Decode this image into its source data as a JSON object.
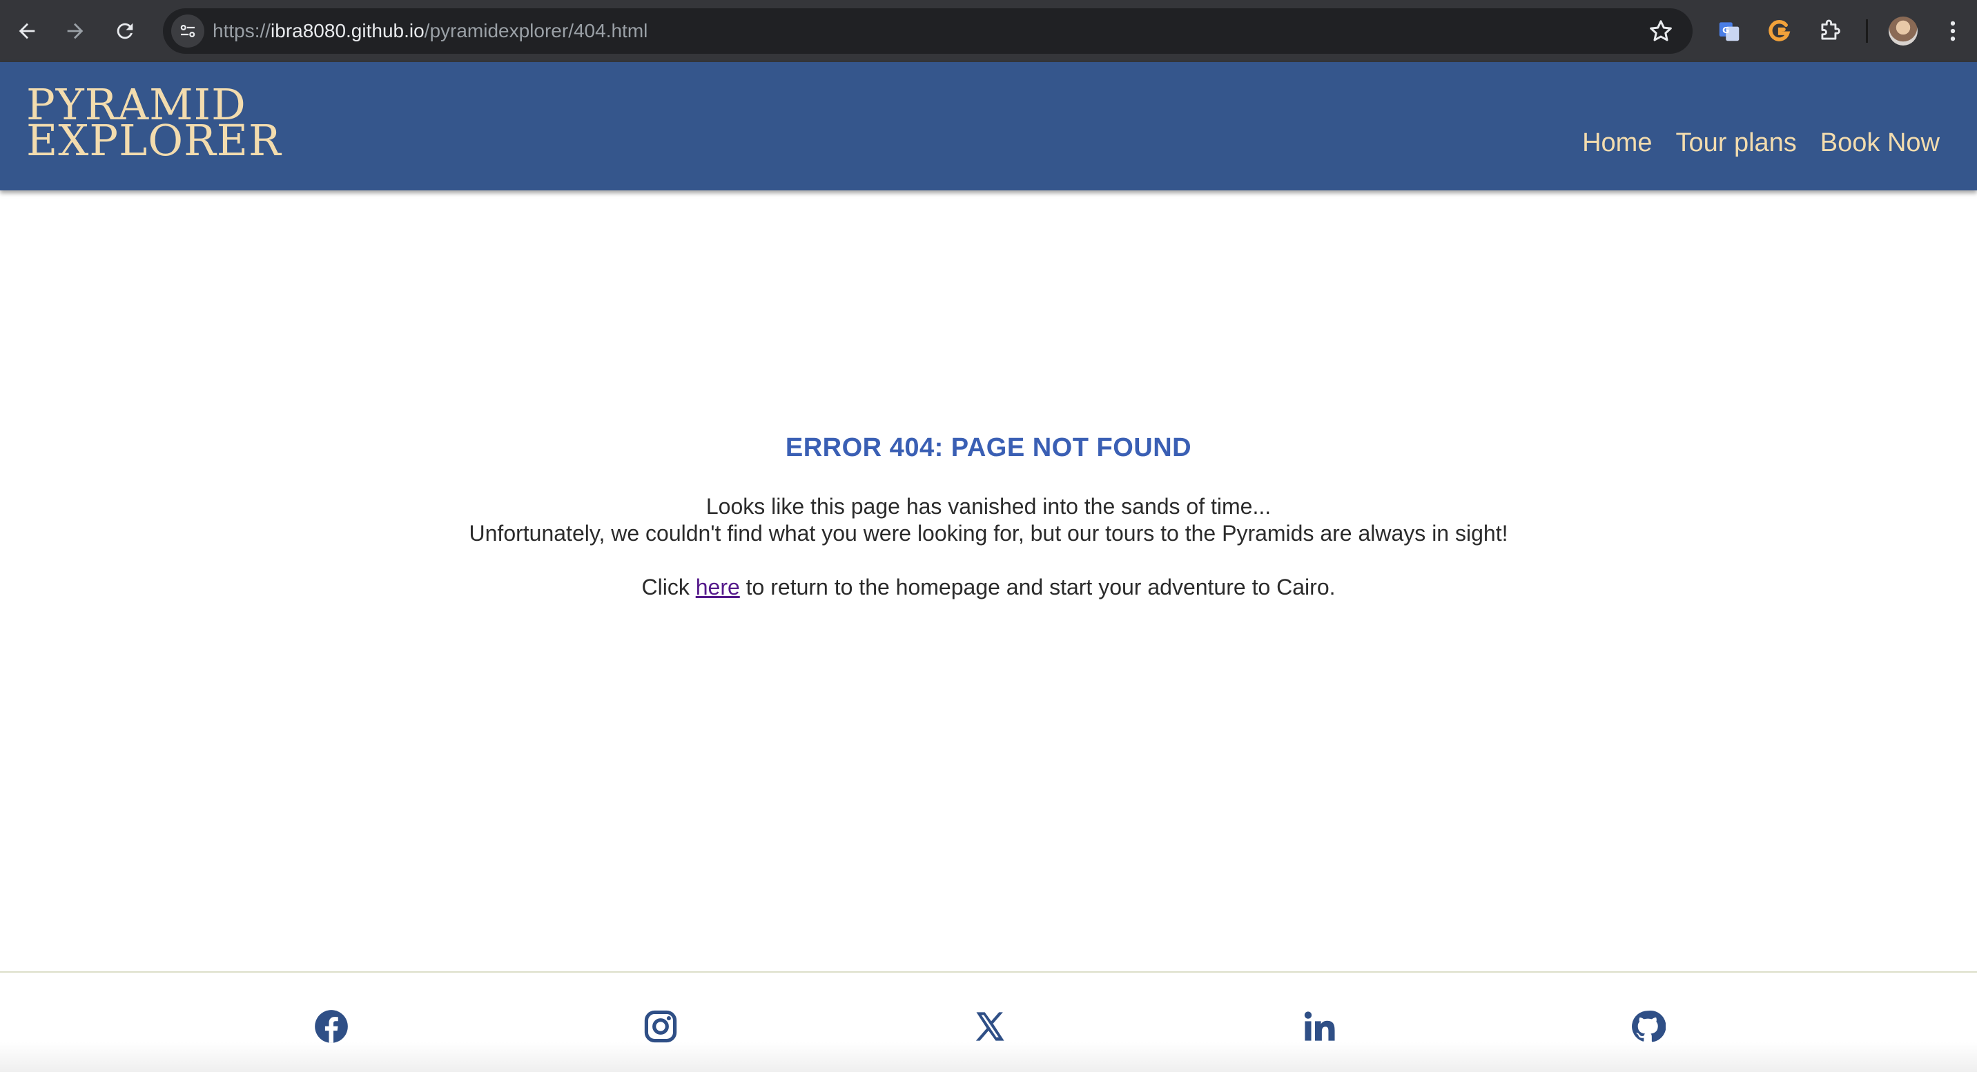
{
  "browser": {
    "url_scheme": "https://",
    "url_host": "ibra8080.github.io",
    "url_path": "/pyramidexplorer/404.html",
    "icons": [
      "back-icon",
      "forward-icon",
      "reload-icon",
      "site-info-icon",
      "bookmark-star-icon",
      "google-translate-icon",
      "extension-g-icon",
      "extensions-puzzle-icon",
      "profile-avatar",
      "more-menu-icon"
    ]
  },
  "header": {
    "logo_line1": "PYRAMID",
    "logo_line2": "EXPLORER",
    "nav": [
      "Home",
      "Tour plans",
      "Book Now"
    ]
  },
  "main": {
    "title": "ERROR 404: PAGE NOT FOUND",
    "line1": "Looks like this page has vanished into the sands of time...",
    "line2": "Unfortunately, we couldn't find what you were looking for, but our tours to the Pyramids are always in sight!",
    "click_prefix": "Click ",
    "link_text": "here",
    "click_suffix": " to return to the homepage and start your adventure to Cairo."
  },
  "footer": {
    "social_icons": [
      "facebook-icon",
      "instagram-icon",
      "x-twitter-icon",
      "linkedin-icon",
      "github-icon"
    ]
  },
  "colors": {
    "header_bg": "#35568c",
    "logo_nav": "#f3dcae",
    "title": "#3a5fb4",
    "icons": "#2f4f86",
    "visited_link": "#551a8b"
  }
}
